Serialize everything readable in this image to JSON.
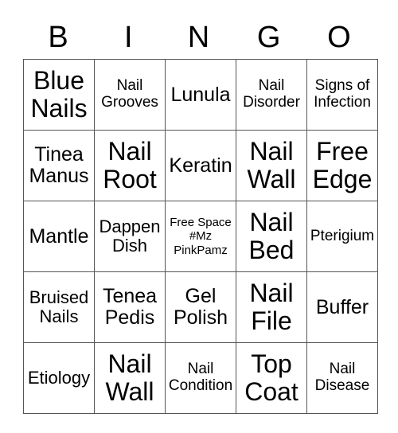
{
  "header": [
    "B",
    "I",
    "N",
    "G",
    "O"
  ],
  "rows": [
    [
      {
        "text": "Blue Nails",
        "size": "xl"
      },
      {
        "text": "Nail Grooves",
        "size": "sm"
      },
      {
        "text": "Lunula",
        "size": "lg"
      },
      {
        "text": "Nail Disorder",
        "size": "sm"
      },
      {
        "text": "Signs of Infection",
        "size": "sm"
      }
    ],
    [
      {
        "text": "Tinea Manus",
        "size": "lg"
      },
      {
        "text": "Nail Root",
        "size": "xl"
      },
      {
        "text": "Keratin",
        "size": "lg"
      },
      {
        "text": "Nail Wall",
        "size": "xl"
      },
      {
        "text": "Free Edge",
        "size": "xl"
      }
    ],
    [
      {
        "text": "Mantle",
        "size": "lg"
      },
      {
        "text": "Dappen Dish",
        "size": "md"
      },
      {
        "text": "Free Space #Mz PinkPamz",
        "size": "xs"
      },
      {
        "text": "Nail Bed",
        "size": "xl"
      },
      {
        "text": "Pterigium",
        "size": "sm"
      }
    ],
    [
      {
        "text": "Bruised Nails",
        "size": "md"
      },
      {
        "text": "Tenea Pedis",
        "size": "lg"
      },
      {
        "text": "Gel Polish",
        "size": "lg"
      },
      {
        "text": "Nail File",
        "size": "xl"
      },
      {
        "text": "Buffer",
        "size": "lg"
      }
    ],
    [
      {
        "text": "Etiology",
        "size": "md"
      },
      {
        "text": "Nail Wall",
        "size": "xl"
      },
      {
        "text": "Nail Condition",
        "size": "sm"
      },
      {
        "text": "Top Coat",
        "size": "xl"
      },
      {
        "text": "Nail Disease",
        "size": "sm"
      }
    ]
  ]
}
